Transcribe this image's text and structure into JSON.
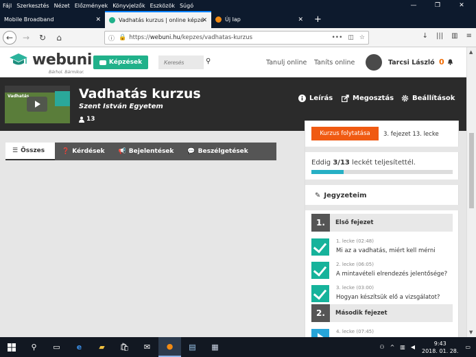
{
  "menubar": {
    "items": [
      "Fájl",
      "Szerkesztés",
      "Nézet",
      "Előzmények",
      "Könyvjelzők",
      "Eszközök",
      "Súgó"
    ]
  },
  "tabs": [
    {
      "title": "Mobile Broadband"
    },
    {
      "title": "Vadhatás kurzus | online képzé"
    },
    {
      "title": "Új lap"
    }
  ],
  "urlbar": {
    "prefix": "https://",
    "host": "webuni.hu",
    "path": "/kepzes/vadhatas-kurzus",
    "more": "•••"
  },
  "header": {
    "logo_text": "webuni",
    "slogan": "Bárhol. Bármikor.",
    "courses_button": "Képzések",
    "search_placeholder": "Keresés",
    "link_learn": "Tanulj online",
    "link_teach": "Taníts online",
    "user_name": "Tarcsi László",
    "notifications": "0"
  },
  "course": {
    "thumb_label": "Vadhatás",
    "title": "Vadhatás kurzus",
    "subtitle": "Szent István Egyetem",
    "enrolled": "13",
    "actions": {
      "description": "Leírás",
      "share": "Megosztás",
      "settings": "Beállítások"
    }
  },
  "filters": {
    "all": "Összes",
    "questions": "Kérdések",
    "announcements": "Bejelentések",
    "discussions": "Beszélgetések"
  },
  "panel": {
    "continue_button": "Kurzus folytatása",
    "continue_location": "3. fejezet 13. lecke",
    "progress_prefix": "Eddig ",
    "progress_value": "3/13",
    "progress_suffix": " leckét teljesítettél.",
    "progress_fraction": 0.23,
    "notes_label": "Jegyzeteim",
    "chapters": [
      {
        "num": "1.",
        "title": "Első fejezet"
      },
      {
        "num": "2.",
        "title": "Második fejezet"
      }
    ],
    "lessons": [
      {
        "meta": "1. lecke (02:48)",
        "title": "Mi az a vadhatás, miért kell mérni"
      },
      {
        "meta": "2. lecke (06:05)",
        "title": "A mintavételi elrendezés jelentősége?"
      },
      {
        "meta": "3. lecke (03:00)",
        "title": "Hogyan készítsük elő a vizsgálatot?"
      },
      {
        "meta": "4. lecke (07:45)",
        "title": ""
      }
    ]
  },
  "taskbar": {
    "time": "9:43",
    "date": "2018. 01. 28."
  },
  "colors": {
    "brand_green": "#20b18a",
    "orange": "#f05a12",
    "teal_check": "#16b39b",
    "progress_blue": "#27b0c5"
  }
}
